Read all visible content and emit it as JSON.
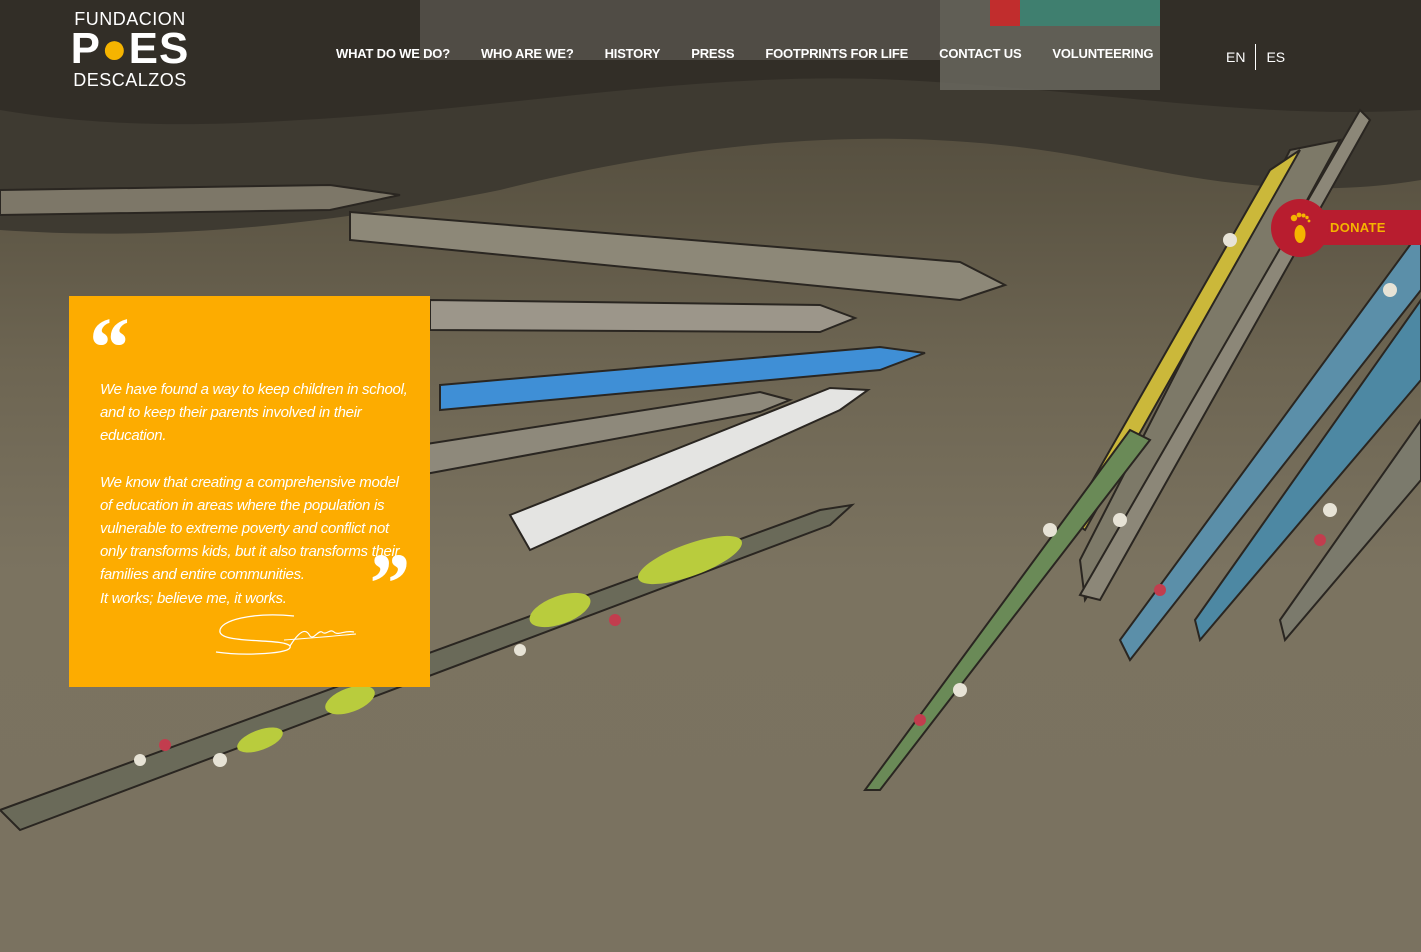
{
  "logo": {
    "line1": "FUNDACION",
    "line2a": "P",
    "line2b": "ES",
    "line3": "DESCALZOS"
  },
  "nav": {
    "items": [
      {
        "label": "WHAT DO WE DO?"
      },
      {
        "label": "WHO ARE WE?"
      },
      {
        "label": "HISTORY"
      },
      {
        "label": "PRESS"
      },
      {
        "label": "FOOTPRINTS FOR LIFE"
      },
      {
        "label": "CONTACT US"
      },
      {
        "label": "VOLUNTEERING"
      }
    ]
  },
  "language": {
    "en": "EN",
    "es": "ES"
  },
  "donate": {
    "label": "DONATE",
    "color": "#b81d2f",
    "text_color": "#f5b400"
  },
  "quote": {
    "open_mark": "“",
    "close_mark": "”",
    "paragraph1": "We have found a way to keep children in school, and to keep their parents involved in their education.",
    "paragraph2": "We know that creating a comprehensive model of education in areas where the population is vulnerable to extreme poverty and conflict not only transforms kids, but it also transforms their families and entire communities.",
    "paragraph3": "It works; believe me, it works.",
    "background_color": "#fdac00"
  },
  "icons": {
    "signature": "signature-icon",
    "donate": "footprint-icon"
  }
}
